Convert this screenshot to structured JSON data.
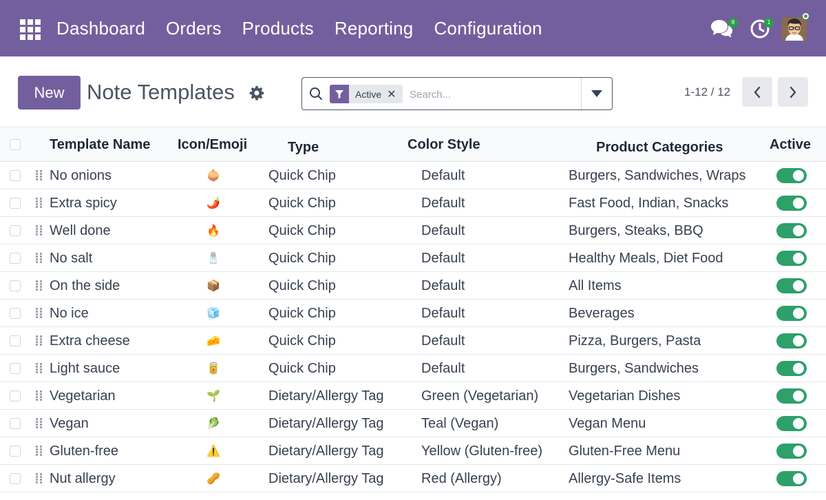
{
  "navbar": {
    "apps_icon": "grid-icon",
    "menu": [
      "Dashboard",
      "Orders",
      "Products",
      "Reporting",
      "Configuration"
    ],
    "chat_badge": "8",
    "activity_badge": "1",
    "colors": {
      "navbar": "#745f9e",
      "badge": "#27a046"
    }
  },
  "control_panel": {
    "new_label": "New",
    "title": "Note Templates",
    "search": {
      "facet_label": "Active",
      "placeholder": "Search..."
    },
    "pager": "1-12 / 12"
  },
  "table": {
    "headers": {
      "name": "Template Name",
      "icon": "Icon/Emoji",
      "type": "Type",
      "color": "Color Style",
      "categories": "Product Categories",
      "active": "Active"
    },
    "rows": [
      {
        "name": "No onions",
        "emoji": "🧅",
        "type": "Quick Chip",
        "color": "Default",
        "categories": "Burgers, Sandwiches, Wraps",
        "active": true
      },
      {
        "name": "Extra spicy",
        "emoji": "🌶️",
        "type": "Quick Chip",
        "color": "Default",
        "categories": "Fast Food, Indian, Snacks",
        "active": true
      },
      {
        "name": "Well done",
        "emoji": "🔥",
        "type": "Quick Chip",
        "color": "Default",
        "categories": "Burgers, Steaks, BBQ",
        "active": true
      },
      {
        "name": "No salt",
        "emoji": "🧂",
        "type": "Quick Chip",
        "color": "Default",
        "categories": "Healthy Meals, Diet Food",
        "active": true
      },
      {
        "name": "On the side",
        "emoji": "📦",
        "type": "Quick Chip",
        "color": "Default",
        "categories": "All Items",
        "active": true
      },
      {
        "name": "No ice",
        "emoji": "🧊",
        "type": "Quick Chip",
        "color": "Default",
        "categories": "Beverages",
        "active": true
      },
      {
        "name": "Extra cheese",
        "emoji": "🧀",
        "type": "Quick Chip",
        "color": "Default",
        "categories": "Pizza, Burgers, Pasta",
        "active": true
      },
      {
        "name": "Light sauce",
        "emoji": "🥫",
        "type": "Quick Chip",
        "color": "Default",
        "categories": "Burgers, Sandwiches",
        "active": true
      },
      {
        "name": "Vegetarian",
        "emoji": "🌱",
        "type": "Dietary/Allergy Tag",
        "color": "Green (Vegetarian)",
        "categories": "Vegetarian Dishes",
        "active": true
      },
      {
        "name": "Vegan",
        "emoji": "🥬",
        "type": "Dietary/Allergy Tag",
        "color": "Teal (Vegan)",
        "categories": "Vegan Menu",
        "active": true
      },
      {
        "name": "Gluten-free",
        "emoji": "⚠️",
        "type": "Dietary/Allergy Tag",
        "color": "Yellow (Gluten-free)",
        "categories": "Gluten-Free Menu",
        "active": true
      },
      {
        "name": "Nut allergy",
        "emoji": "🥜",
        "type": "Dietary/Allergy Tag",
        "color": "Red (Allergy)",
        "categories": "Allergy-Safe Items",
        "active": true
      }
    ]
  },
  "colors": {
    "toggle_on": "#2ea06a",
    "primary": "#745f9e"
  }
}
